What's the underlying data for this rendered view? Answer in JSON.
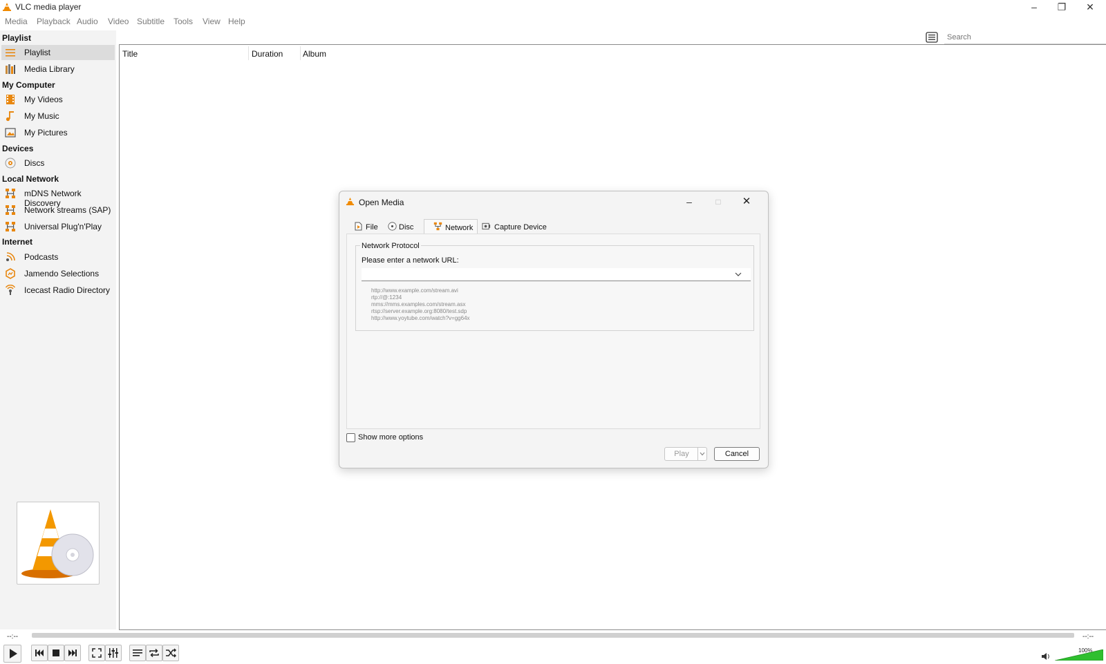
{
  "window": {
    "title": "VLC media player"
  },
  "menu": [
    "Media",
    "Playback",
    "Audio",
    "Video",
    "Subtitle",
    "Tools",
    "View",
    "Help"
  ],
  "sidebar": {
    "sections": {
      "playlist": "Playlist",
      "my_computer": "My Computer",
      "devices": "Devices",
      "local_network": "Local Network",
      "internet": "Internet"
    },
    "items": {
      "playlist": "Playlist",
      "media_library": "Media Library",
      "my_videos": "My Videos",
      "my_music": "My Music",
      "my_pictures": "My Pictures",
      "discs": "Discs",
      "mdns": "mDNS Network Discovery",
      "sap": "Network streams (SAP)",
      "upnp": "Universal Plug'n'Play",
      "podcasts": "Podcasts",
      "jamendo": "Jamendo Selections",
      "icecast": "Icecast Radio Directory"
    }
  },
  "search": {
    "placeholder": "Search"
  },
  "playlist_columns": [
    "Title",
    "Duration",
    "Album"
  ],
  "dialog": {
    "title": "Open Media",
    "tabs": [
      "File",
      "Disc",
      "Network",
      "Capture Device"
    ],
    "active_tab": "Network",
    "group_title": "Network Protocol",
    "url_label": "Please enter a network URL:",
    "url_value": "",
    "examples": [
      "http://www.example.com/stream.avi",
      "rtp://@:1234",
      "mms://mms.examples.com/stream.asx",
      "rtsp://server.example.org:8080/test.sdp",
      "http://www.yoytube.com/watch?v=gg64x"
    ],
    "show_more": "Show more options",
    "play": "Play",
    "cancel": "Cancel"
  },
  "player": {
    "time_left": "--:--",
    "time_right": "--:--",
    "volume": "100%"
  },
  "colors": {
    "accent": "#e8870f",
    "volume": "#2fbf2f"
  }
}
